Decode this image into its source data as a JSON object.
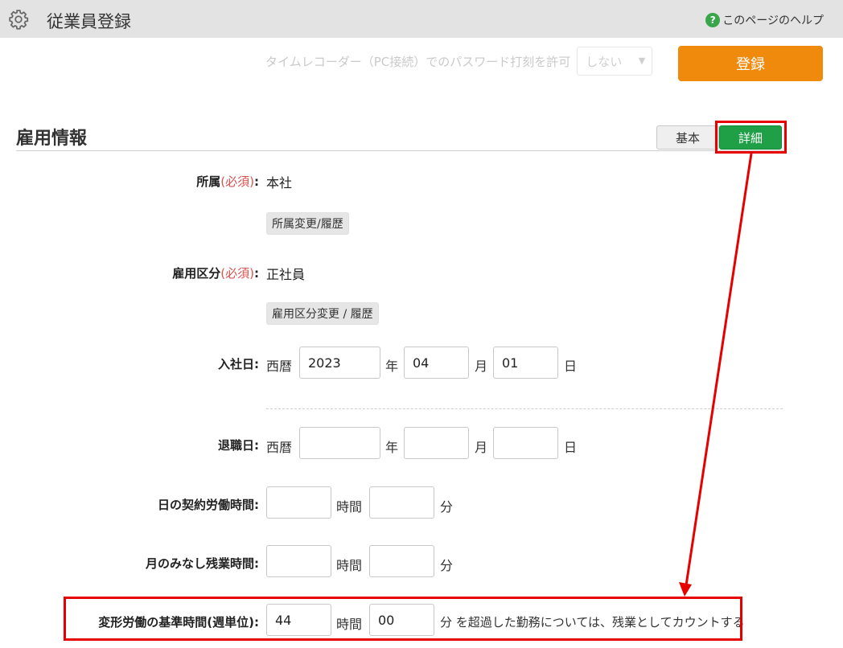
{
  "header": {
    "title": "従業員登録",
    "help_label": "このページのヘルプ",
    "help_icon": "?"
  },
  "faded": {
    "label": "タイムレコーダー（PC接続）でのパスワード打刻を許可",
    "select_value": "しない"
  },
  "register_label": "登録",
  "section": {
    "title": "雇用情報",
    "tab_basic": "基本",
    "tab_detail": "詳細"
  },
  "required_text": "(必須)",
  "affiliation": {
    "label": "所属",
    "value": "本社",
    "button": "所属変更/履歴"
  },
  "employment_type": {
    "label": "雇用区分",
    "value": "正社員",
    "button": "雇用区分変更 / 履歴"
  },
  "hire_date": {
    "label": "入社日:",
    "era": "西暦",
    "year": "2023",
    "month": "04",
    "day": "01"
  },
  "retire_date": {
    "label": "退職日:",
    "era": "西暦",
    "year": "",
    "month": "",
    "day": ""
  },
  "units": {
    "year": "年",
    "month": "月",
    "day": "日",
    "hour": "時間",
    "minute": "分"
  },
  "daily_contract": {
    "label": "日の契約労働時間:",
    "hours": "",
    "minutes": ""
  },
  "monthly_overtime": {
    "label": "月のみなし残業時間:",
    "hours": "",
    "minutes": ""
  },
  "flex_base": {
    "label": "変形労働の基準時間(週単位):",
    "hours": "44",
    "minutes": "00",
    "suffix": "分 を超過した勤務については、残業としてカウントする"
  },
  "colors": {
    "header_bg": "#e3e3e3",
    "register": "#f08a0c",
    "detail_tab": "#1f9f46",
    "highlight": "#e60000",
    "required": "#d9534f"
  }
}
